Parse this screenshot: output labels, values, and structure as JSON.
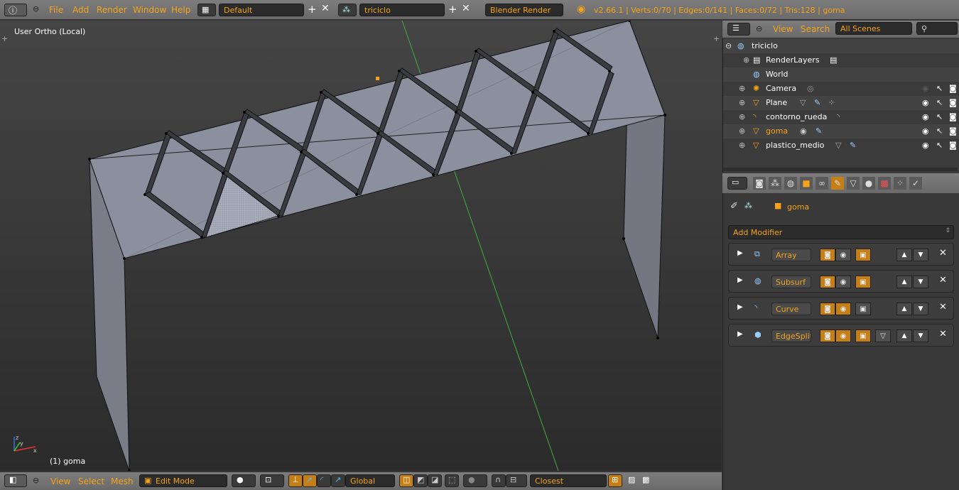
{
  "topbar": {
    "menus": [
      "File",
      "Add",
      "Render",
      "Window",
      "Help"
    ],
    "layout": "Default",
    "scene": "triciclo",
    "engine": "Blender Render",
    "stats": "v2.66.1 | Verts:0/70 | Edges:0/141 | Faces:0/72 | Tris:128 | goma"
  },
  "viewport": {
    "view_label": "User Ortho (Local)",
    "object_label": "(1) goma"
  },
  "outliner": {
    "view": "View",
    "search": "Search",
    "scenes": "All Scenes",
    "items": [
      "triciclo",
      "RenderLayers",
      "World",
      "Camera",
      "Plane",
      "contorno_rueda",
      "goma",
      "plastico_medio"
    ]
  },
  "properties": {
    "object_name": "goma",
    "add_modifier": "Add Modifier",
    "modifiers": [
      "Array",
      "Subsurf",
      "Curve",
      "EdgeSplit"
    ]
  },
  "bottombar": {
    "menus": [
      "View",
      "Select",
      "Mesh"
    ],
    "mode": "Edit Mode",
    "orientation": "Global",
    "snap": "Closest"
  },
  "colors": {
    "accent": "#f5a31a",
    "header": "#727272",
    "face": "#8c8f9e"
  }
}
